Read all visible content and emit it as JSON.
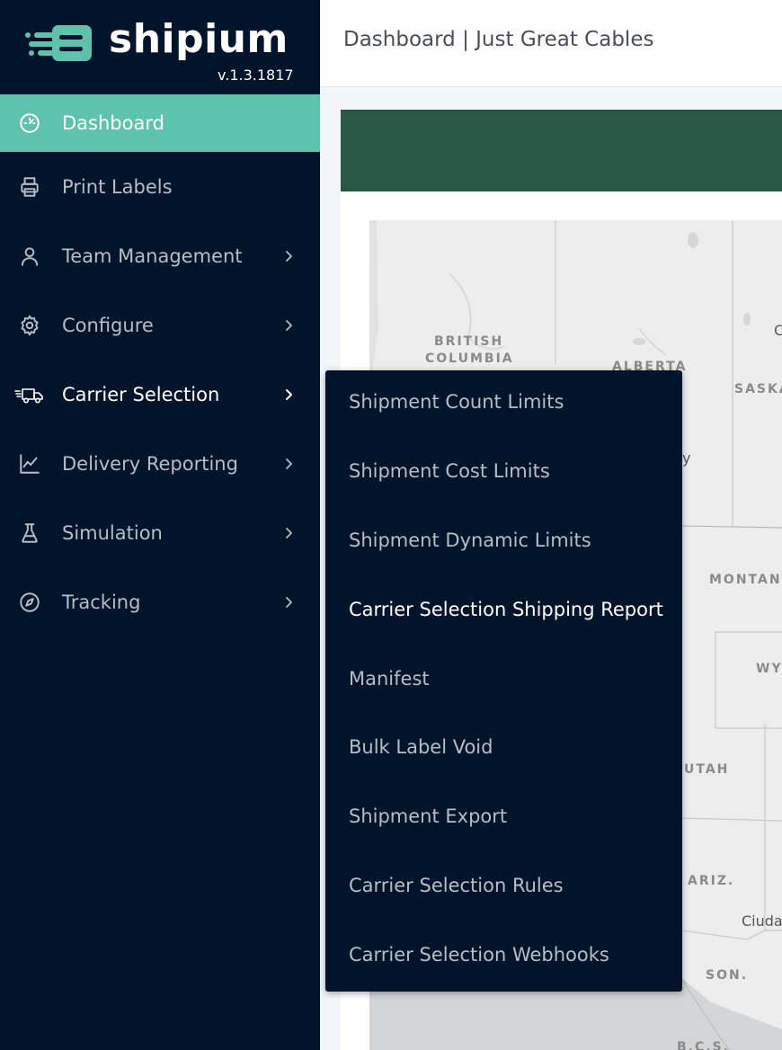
{
  "brand": {
    "name": "shipium",
    "version": "v.1.3.1817",
    "accent_color": "#5fc2ad"
  },
  "header": {
    "title": "Dashboard | Just Great Cables"
  },
  "sidebar": {
    "items": [
      {
        "label": "Dashboard",
        "icon": "dashboard-gauge-icon",
        "active": true
      },
      {
        "label": "Print Labels",
        "icon": "printer-icon"
      },
      {
        "label": "Team Management",
        "icon": "user-icon"
      },
      {
        "label": "Configure",
        "icon": "gear-icon"
      },
      {
        "label": "Carrier Selection",
        "icon": "delivery-truck-icon"
      },
      {
        "label": "Delivery Reporting",
        "icon": "line-chart-icon"
      },
      {
        "label": "Simulation",
        "icon": "flask-icon"
      },
      {
        "label": "Tracking",
        "icon": "compass-icon"
      }
    ]
  },
  "flyout": {
    "items": [
      "Shipment Count Limits",
      "Shipment Cost Limits",
      "Shipment Dynamic Limits",
      "Carrier Selection Shipping Report",
      "Manifest",
      "Bulk Label Void",
      "Shipment Export",
      "Carrier Selection Rules",
      "Carrier Selection Webhooks"
    ]
  },
  "map": {
    "labels": {
      "british_columbia_1": "BRITISH",
      "british_columbia_2": "COLUMBIA",
      "alberta": "ALBERTA",
      "saskatchewan": "SASKA",
      "montana": "MONTANA",
      "wyoming": "WY",
      "utah": "UTAH",
      "arizona": "ARIZ.",
      "sonora": "SON.",
      "bcs": "B.C.S.",
      "ciudad": "Ciuda",
      "y_fragment": "y",
      "c_fragment": "C"
    }
  }
}
